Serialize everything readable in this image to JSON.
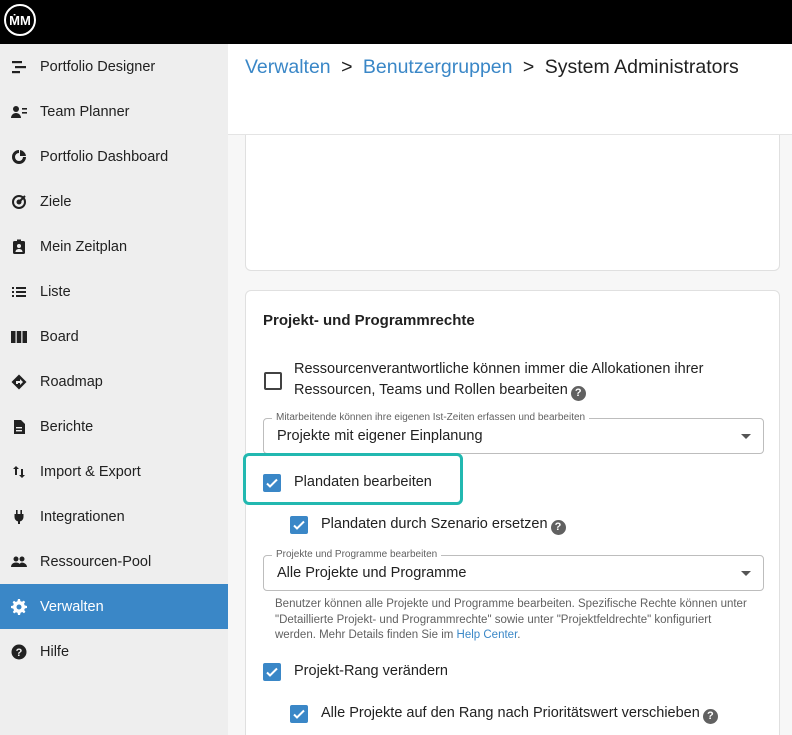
{
  "app": {
    "logo_text": "ṀM"
  },
  "sidebar": {
    "items": [
      {
        "label": "Portfolio Designer",
        "icon": "portfolio-designer-icon"
      },
      {
        "label": "Team Planner",
        "icon": "team-planner-icon"
      },
      {
        "label": "Portfolio Dashboard",
        "icon": "dashboard-icon"
      },
      {
        "label": "Ziele",
        "icon": "target-icon"
      },
      {
        "label": "Mein Zeitplan",
        "icon": "schedule-icon"
      },
      {
        "label": "Liste",
        "icon": "list-icon"
      },
      {
        "label": "Board",
        "icon": "board-icon"
      },
      {
        "label": "Roadmap",
        "icon": "roadmap-icon"
      },
      {
        "label": "Berichte",
        "icon": "report-icon"
      },
      {
        "label": "Import & Export",
        "icon": "import-export-icon"
      },
      {
        "label": "Integrationen",
        "icon": "plug-icon"
      },
      {
        "label": "Ressourcen-Pool",
        "icon": "people-icon"
      },
      {
        "label": "Verwalten",
        "icon": "gear-icon",
        "active": true
      },
      {
        "label": "Hilfe",
        "icon": "help-icon"
      }
    ]
  },
  "breadcrumb": {
    "items": [
      "Verwalten",
      "Benutzergruppen"
    ],
    "current": "System Administrators",
    "separator": ">"
  },
  "section": {
    "title": "Projekt- und Programmrechte",
    "resource_managers": {
      "line1": "Ressourcenverantwortliche können immer die Allokationen ihrer",
      "line2": "Ressourcen, Teams und Rollen bearbeiten",
      "checked": false
    },
    "actuals_select": {
      "legend": "Mitarbeitende können ihre eigenen Ist-Zeiten erfassen und bearbeiten",
      "value": "Projekte mit eigener Einplanung"
    },
    "edit_plandata": {
      "label": "Plandaten bearbeiten",
      "checked": true
    },
    "replace_by_scenario": {
      "label": "Plandaten durch Szenario ersetzen",
      "checked": true
    },
    "projects_select": {
      "legend": "Projekte und Programme bearbeiten",
      "value": "Alle Projekte und Programme"
    },
    "hint": {
      "text": "Benutzer können alle Projekte und Programme bearbeiten. Spezifische Rechte können unter \"Detaillierte Projekt- und Programmrechte\" sowie unter \"Projektfeldrechte\" konfiguriert werden. Mehr Details finden Sie im ",
      "link": "Help Center",
      "end": "."
    },
    "change_rank": {
      "label": "Projekt-Rang verändern",
      "checked": true
    },
    "move_by_priority": {
      "label": "Alle Projekte auf den Rang nach Prioritätswert verschieben",
      "checked": true
    }
  },
  "colors": {
    "accent": "#3a87c7",
    "highlight": "#22b8b0"
  }
}
